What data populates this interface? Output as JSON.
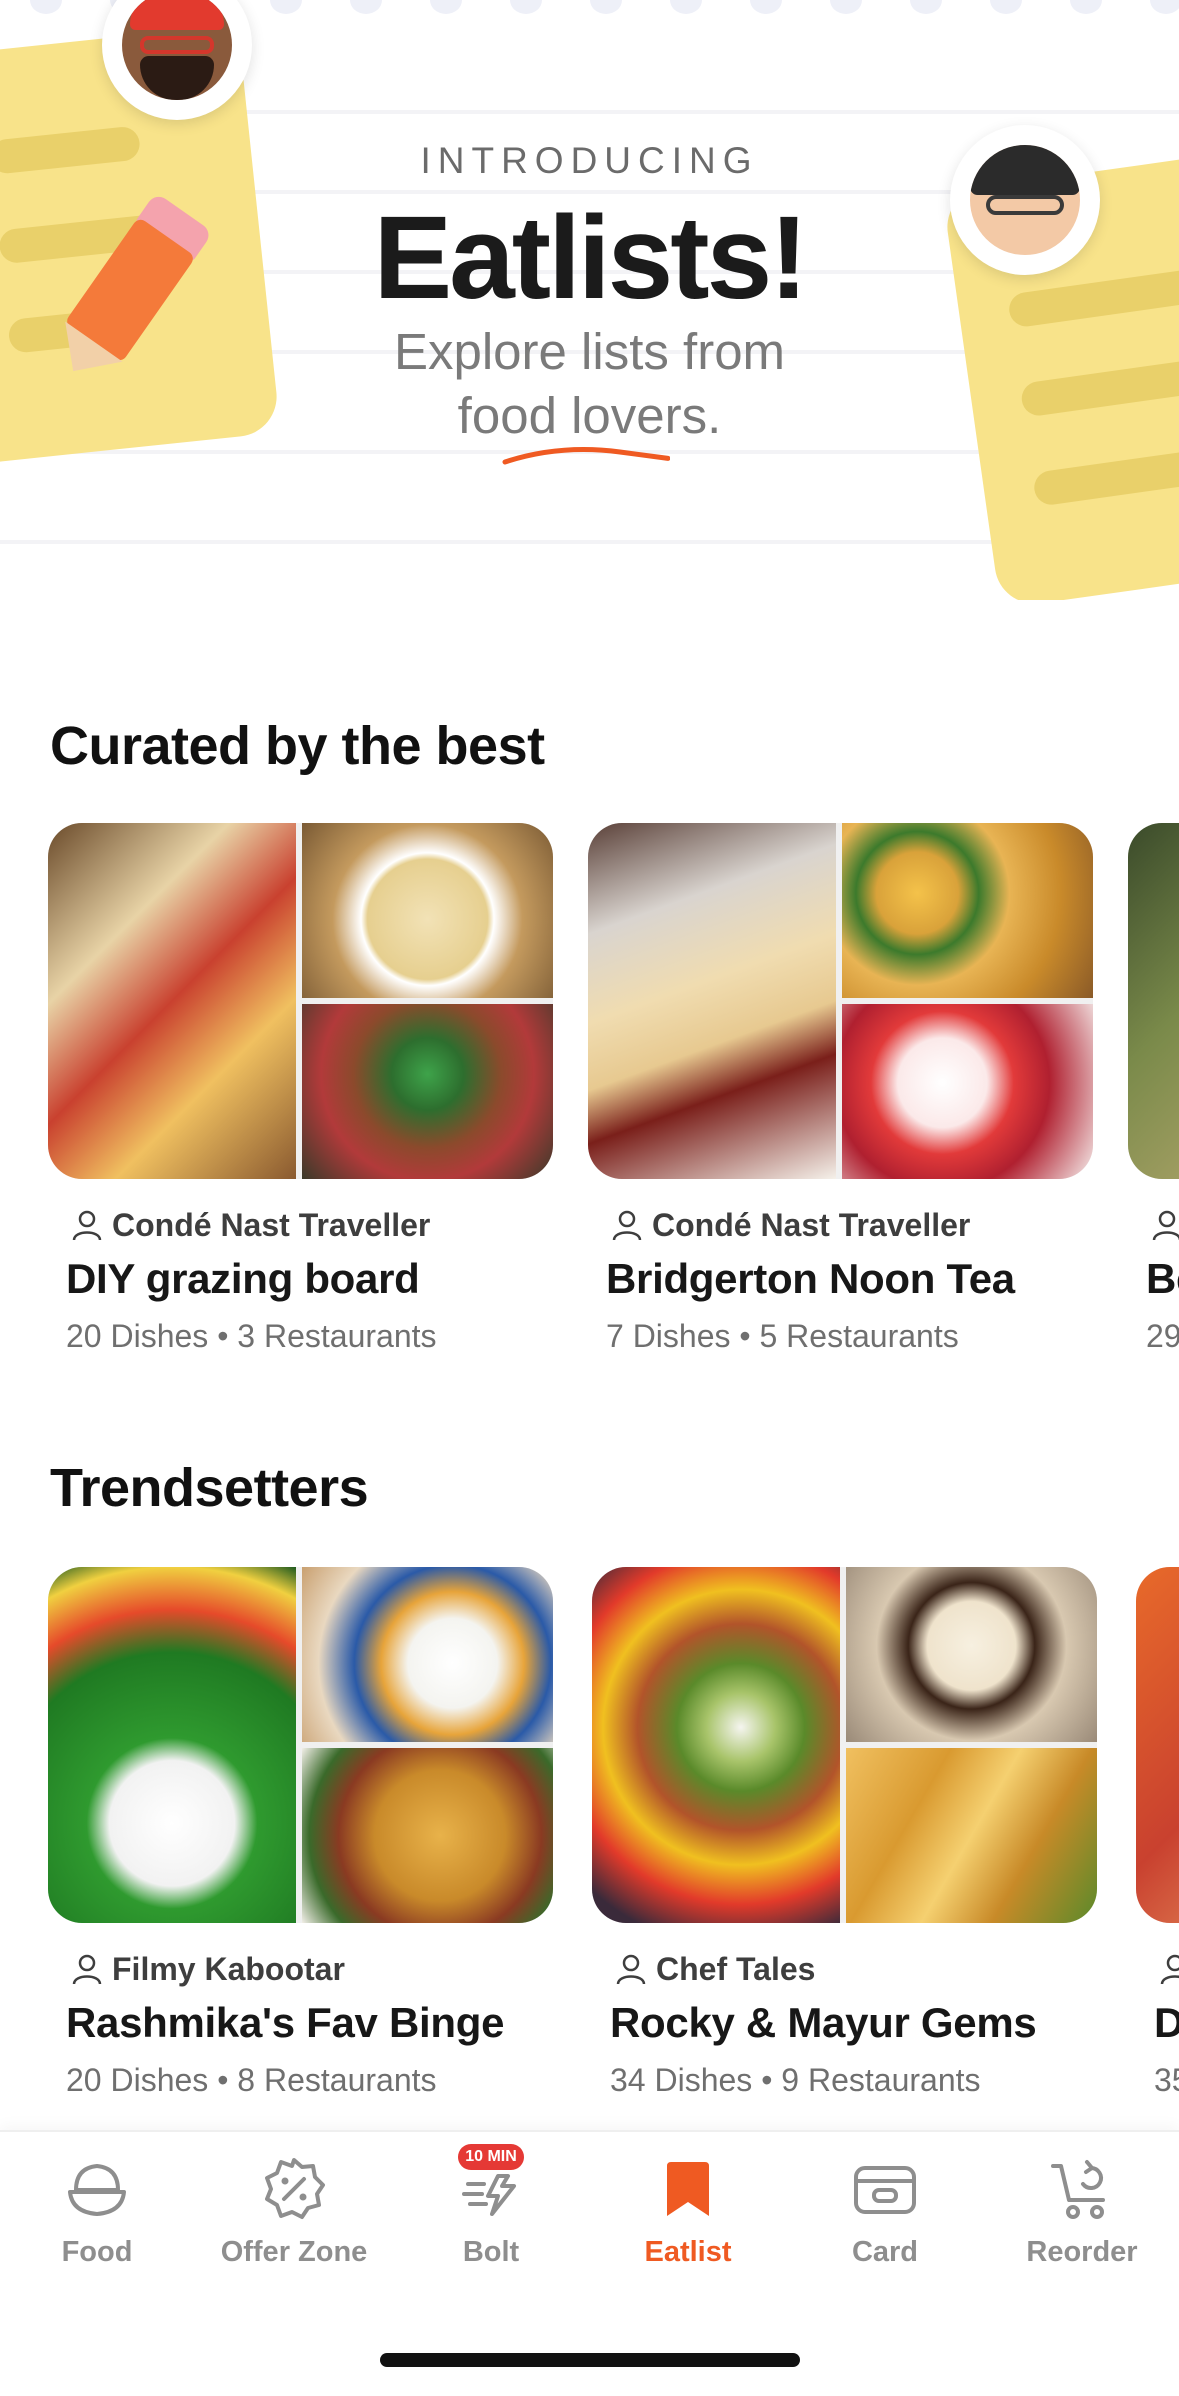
{
  "hero": {
    "eyebrow": "INTRODUCING",
    "title": "Eatlists!",
    "subtitle_line1": "Explore lists from",
    "subtitle_line2": "food lovers."
  },
  "sections": [
    {
      "title": "Curated by the best",
      "cards": [
        {
          "author": "Condé Nast Traveller",
          "title": "DIY grazing board",
          "dishes": "20 Dishes",
          "restaurants": "3 Restaurants",
          "separator": "•"
        },
        {
          "author": "Condé Nast Traveller",
          "title": "Bridgerton Noon Tea",
          "dishes": "7 Dishes",
          "restaurants": "5 Restaurants",
          "separator": "•"
        },
        {
          "author": "",
          "title": "Be",
          "dishes": "29",
          "restaurants": "",
          "separator": ""
        }
      ]
    },
    {
      "title": "Trendsetters",
      "cards": [
        {
          "author": "Filmy Kabootar",
          "title": "Rashmika's Fav Binge",
          "dishes": "20 Dishes",
          "restaurants": "8 Restaurants",
          "separator": "•"
        },
        {
          "author": "Chef Tales",
          "title": "Rocky & Mayur Gems",
          "dishes": "34 Dishes",
          "restaurants": "9 Restaurants",
          "separator": "•"
        },
        {
          "author": "",
          "title": "D",
          "dishes": "35",
          "restaurants": "",
          "separator": ""
        }
      ]
    }
  ],
  "bottom_nav": {
    "items": [
      {
        "label": "Food",
        "icon": "food-bowl-icon"
      },
      {
        "label": "Offer Zone",
        "icon": "offer-badge-icon"
      },
      {
        "label": "Bolt",
        "icon": "bolt-delivery-icon",
        "badge": "10 MIN"
      },
      {
        "label": "Eatlist",
        "icon": "bookmark-icon",
        "active": true
      },
      {
        "label": "Card",
        "icon": "card-icon"
      },
      {
        "label": "Reorder",
        "icon": "reorder-icon"
      }
    ]
  },
  "colors": {
    "accent": "#ef5a22",
    "note_yellow": "#f8e38a",
    "inactive_nav": "#8e8e8e",
    "badge_red": "#e53935"
  }
}
